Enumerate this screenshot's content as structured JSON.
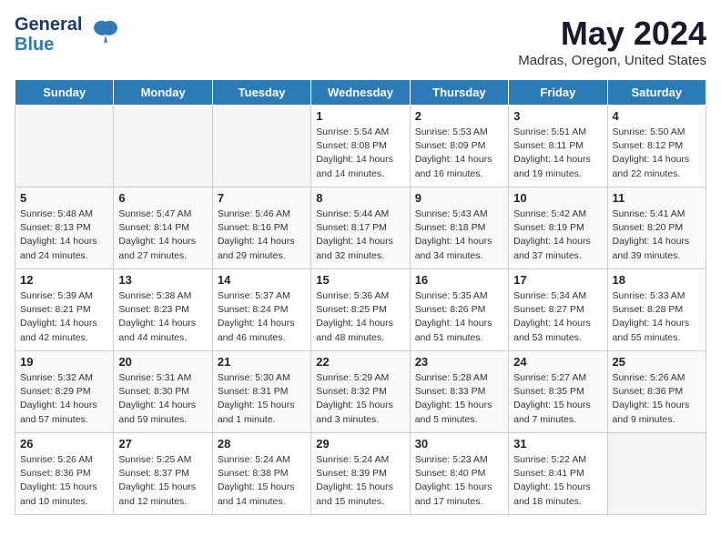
{
  "header": {
    "logo_line1": "General",
    "logo_line2": "Blue",
    "month": "May 2024",
    "location": "Madras, Oregon, United States"
  },
  "days_of_week": [
    "Sunday",
    "Monday",
    "Tuesday",
    "Wednesday",
    "Thursday",
    "Friday",
    "Saturday"
  ],
  "weeks": [
    [
      {
        "day": "",
        "info": ""
      },
      {
        "day": "",
        "info": ""
      },
      {
        "day": "",
        "info": ""
      },
      {
        "day": "1",
        "info": "Sunrise: 5:54 AM\nSunset: 8:08 PM\nDaylight: 14 hours\nand 14 minutes."
      },
      {
        "day": "2",
        "info": "Sunrise: 5:53 AM\nSunset: 8:09 PM\nDaylight: 14 hours\nand 16 minutes."
      },
      {
        "day": "3",
        "info": "Sunrise: 5:51 AM\nSunset: 8:11 PM\nDaylight: 14 hours\nand 19 minutes."
      },
      {
        "day": "4",
        "info": "Sunrise: 5:50 AM\nSunset: 8:12 PM\nDaylight: 14 hours\nand 22 minutes."
      }
    ],
    [
      {
        "day": "5",
        "info": "Sunrise: 5:48 AM\nSunset: 8:13 PM\nDaylight: 14 hours\nand 24 minutes."
      },
      {
        "day": "6",
        "info": "Sunrise: 5:47 AM\nSunset: 8:14 PM\nDaylight: 14 hours\nand 27 minutes."
      },
      {
        "day": "7",
        "info": "Sunrise: 5:46 AM\nSunset: 8:16 PM\nDaylight: 14 hours\nand 29 minutes."
      },
      {
        "day": "8",
        "info": "Sunrise: 5:44 AM\nSunset: 8:17 PM\nDaylight: 14 hours\nand 32 minutes."
      },
      {
        "day": "9",
        "info": "Sunrise: 5:43 AM\nSunset: 8:18 PM\nDaylight: 14 hours\nand 34 minutes."
      },
      {
        "day": "10",
        "info": "Sunrise: 5:42 AM\nSunset: 8:19 PM\nDaylight: 14 hours\nand 37 minutes."
      },
      {
        "day": "11",
        "info": "Sunrise: 5:41 AM\nSunset: 8:20 PM\nDaylight: 14 hours\nand 39 minutes."
      }
    ],
    [
      {
        "day": "12",
        "info": "Sunrise: 5:39 AM\nSunset: 8:21 PM\nDaylight: 14 hours\nand 42 minutes."
      },
      {
        "day": "13",
        "info": "Sunrise: 5:38 AM\nSunset: 8:23 PM\nDaylight: 14 hours\nand 44 minutes."
      },
      {
        "day": "14",
        "info": "Sunrise: 5:37 AM\nSunset: 8:24 PM\nDaylight: 14 hours\nand 46 minutes."
      },
      {
        "day": "15",
        "info": "Sunrise: 5:36 AM\nSunset: 8:25 PM\nDaylight: 14 hours\nand 48 minutes."
      },
      {
        "day": "16",
        "info": "Sunrise: 5:35 AM\nSunset: 8:26 PM\nDaylight: 14 hours\nand 51 minutes."
      },
      {
        "day": "17",
        "info": "Sunrise: 5:34 AM\nSunset: 8:27 PM\nDaylight: 14 hours\nand 53 minutes."
      },
      {
        "day": "18",
        "info": "Sunrise: 5:33 AM\nSunset: 8:28 PM\nDaylight: 14 hours\nand 55 minutes."
      }
    ],
    [
      {
        "day": "19",
        "info": "Sunrise: 5:32 AM\nSunset: 8:29 PM\nDaylight: 14 hours\nand 57 minutes."
      },
      {
        "day": "20",
        "info": "Sunrise: 5:31 AM\nSunset: 8:30 PM\nDaylight: 14 hours\nand 59 minutes."
      },
      {
        "day": "21",
        "info": "Sunrise: 5:30 AM\nSunset: 8:31 PM\nDaylight: 15 hours\nand 1 minute."
      },
      {
        "day": "22",
        "info": "Sunrise: 5:29 AM\nSunset: 8:32 PM\nDaylight: 15 hours\nand 3 minutes."
      },
      {
        "day": "23",
        "info": "Sunrise: 5:28 AM\nSunset: 8:33 PM\nDaylight: 15 hours\nand 5 minutes."
      },
      {
        "day": "24",
        "info": "Sunrise: 5:27 AM\nSunset: 8:35 PM\nDaylight: 15 hours\nand 7 minutes."
      },
      {
        "day": "25",
        "info": "Sunrise: 5:26 AM\nSunset: 8:36 PM\nDaylight: 15 hours\nand 9 minutes."
      }
    ],
    [
      {
        "day": "26",
        "info": "Sunrise: 5:26 AM\nSunset: 8:36 PM\nDaylight: 15 hours\nand 10 minutes."
      },
      {
        "day": "27",
        "info": "Sunrise: 5:25 AM\nSunset: 8:37 PM\nDaylight: 15 hours\nand 12 minutes."
      },
      {
        "day": "28",
        "info": "Sunrise: 5:24 AM\nSunset: 8:38 PM\nDaylight: 15 hours\nand 14 minutes."
      },
      {
        "day": "29",
        "info": "Sunrise: 5:24 AM\nSunset: 8:39 PM\nDaylight: 15 hours\nand 15 minutes."
      },
      {
        "day": "30",
        "info": "Sunrise: 5:23 AM\nSunset: 8:40 PM\nDaylight: 15 hours\nand 17 minutes."
      },
      {
        "day": "31",
        "info": "Sunrise: 5:22 AM\nSunset: 8:41 PM\nDaylight: 15 hours\nand 18 minutes."
      },
      {
        "day": "",
        "info": ""
      }
    ]
  ]
}
